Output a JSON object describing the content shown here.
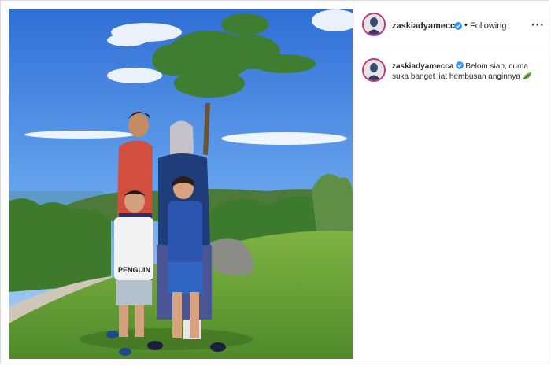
{
  "post": {
    "username": "zaskiadyamecca",
    "follow_status": "Following",
    "separator": "•",
    "more_label": "···",
    "caption_username": "zaskiadyamecca",
    "caption": "Belom siap, cuma suka banget liat hembusan anginnya",
    "caption_emoji": "leaf-icon",
    "photo_shirt_text": "PENGUIN"
  },
  "colors": {
    "story_ring": "#c13584",
    "verified": "#3897f0",
    "text": "#262626",
    "border": "#dbdbdb"
  },
  "icons": {
    "verified": "verified-badge-icon",
    "more": "more-options-icon",
    "emoji": "leaf-icon"
  }
}
